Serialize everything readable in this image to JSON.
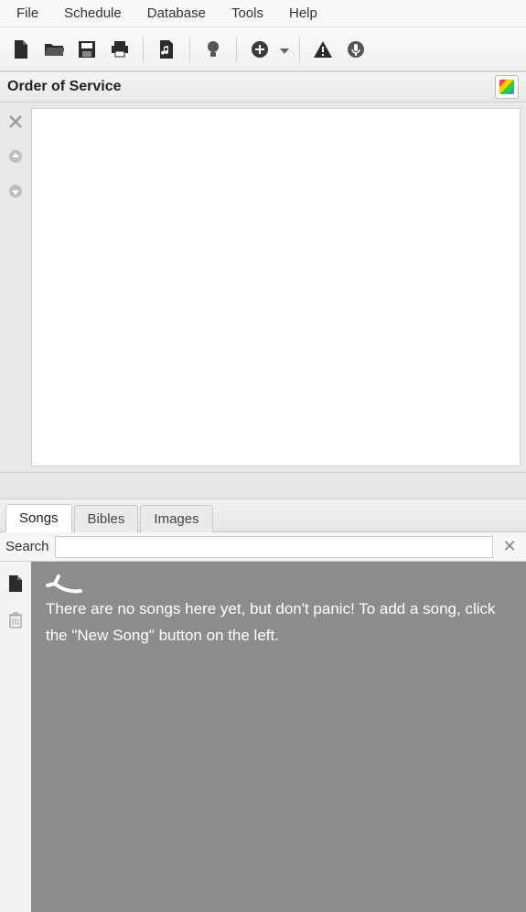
{
  "menu": {
    "items": [
      "File",
      "Schedule",
      "Database",
      "Tools",
      "Help"
    ]
  },
  "toolbar": {
    "icons": [
      "new-file-icon",
      "open-folder-icon",
      "save-icon",
      "print-icon",
      "SEP",
      "music-file-icon",
      "SEP",
      "idea-bulb-icon",
      "SEP",
      "add-plus-icon",
      "dropdown-caret-icon",
      "SEP",
      "warning-triangle-icon",
      "microphone-icon"
    ]
  },
  "order_panel": {
    "title": "Order of Service",
    "side_buttons": [
      "remove-x-icon",
      "move-up-icon",
      "move-down-icon"
    ]
  },
  "tabs": [
    {
      "label": "Songs",
      "active": true
    },
    {
      "label": "Bibles",
      "active": false
    },
    {
      "label": "Images",
      "active": false
    }
  ],
  "search": {
    "label": "Search",
    "value": "",
    "placeholder": ""
  },
  "songs_panel": {
    "side_buttons": [
      "new-song-icon",
      "delete-trash-icon"
    ],
    "empty_hint": "There are no songs here yet, but don't panic! To add a song, click the \"New Song\" button on the left."
  }
}
